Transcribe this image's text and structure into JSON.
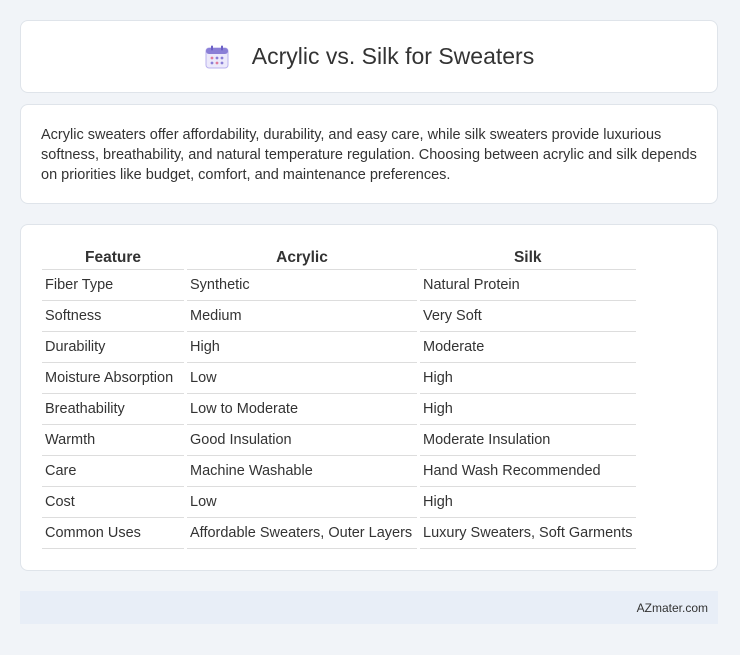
{
  "header": {
    "title": "Acrylic vs. Silk for Sweaters",
    "icon": "calendar-icon"
  },
  "intro": {
    "text": "Acrylic sweaters offer affordability, durability, and easy care, while silk sweaters provide luxurious softness, breathability, and natural temperature regulation. Choosing between acrylic and silk depends on priorities like budget, comfort, and maintenance preferences."
  },
  "table": {
    "headers": [
      "Feature",
      "Acrylic",
      "Silk"
    ],
    "rows": [
      [
        "Fiber Type",
        "Synthetic",
        "Natural Protein"
      ],
      [
        "Softness",
        "Medium",
        "Very Soft"
      ],
      [
        "Durability",
        "High",
        "Moderate"
      ],
      [
        "Moisture Absorption",
        "Low",
        "High"
      ],
      [
        "Breathability",
        "Low to Moderate",
        "High"
      ],
      [
        "Warmth",
        "Good Insulation",
        "Moderate Insulation"
      ],
      [
        "Care",
        "Machine Washable",
        "Hand Wash Recommended"
      ],
      [
        "Cost",
        "Low",
        "High"
      ],
      [
        "Common Uses",
        "Affordable Sweaters, Outer Layers",
        "Luxury Sweaters, Soft Garments"
      ]
    ]
  },
  "footer": {
    "brand": "AZmater.com"
  },
  "colors": {
    "background": "#f1f4f8",
    "footer": "#e8eef7",
    "icon_accent": "#8a7fd6"
  }
}
